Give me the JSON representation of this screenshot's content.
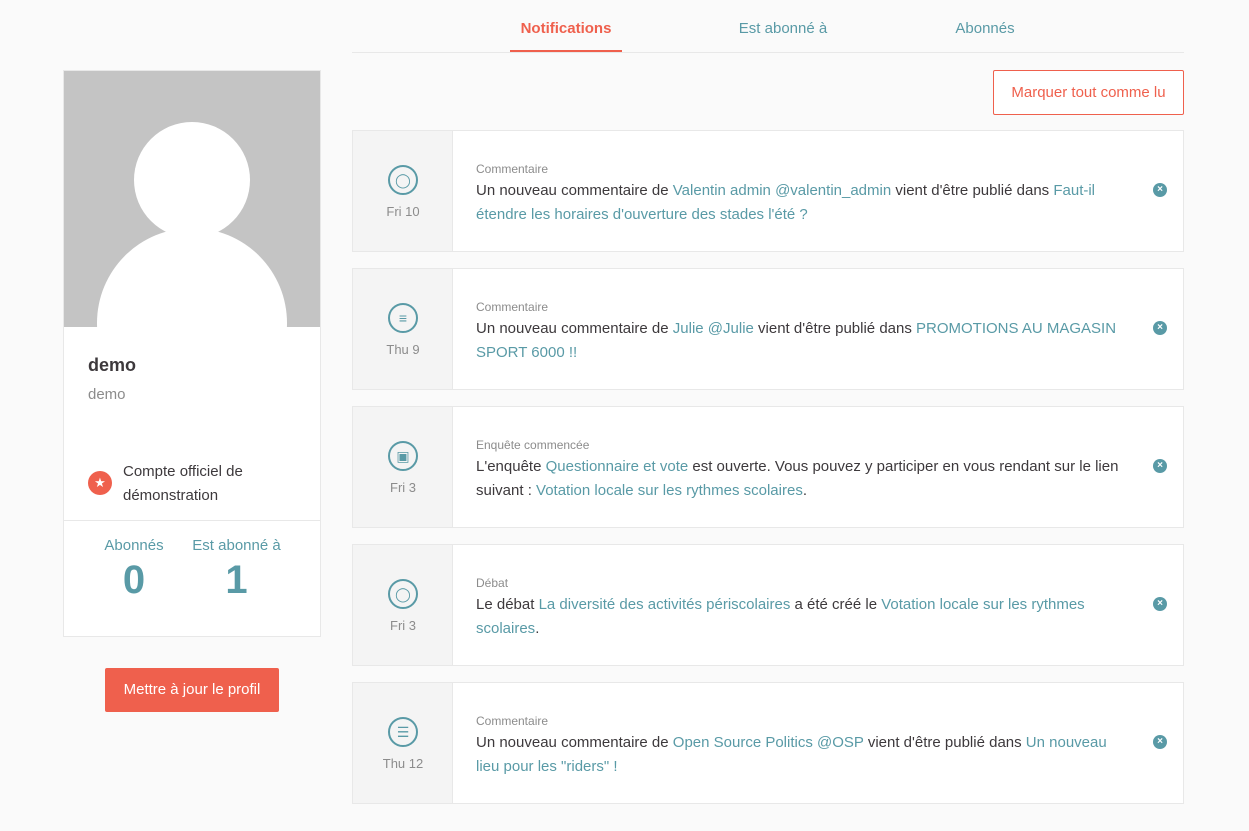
{
  "tabs": [
    {
      "label": "Notifications"
    },
    {
      "label": "Est abonné à"
    },
    {
      "label": "Abonnés"
    }
  ],
  "profile": {
    "name": "demo",
    "nickname": "demo",
    "official_label": "Compte officiel de démonstration",
    "followers_label": "Abonnés",
    "followers_count": "0",
    "following_label": "Est abonné à",
    "following_count": "1",
    "update_button": "Mettre à jour le profil"
  },
  "actions": {
    "mark_all_read": "Marquer tout comme lu"
  },
  "colors": {
    "accent": "#ef604d",
    "link": "#599aa6"
  },
  "notifications": [
    {
      "icon": "comment-bubble-icon",
      "day": "Fri 10",
      "category": "Commentaire",
      "t1": "Un nouveau commentaire de ",
      "l1": "Valentin admin @valentin_admin",
      "t2": " vient d'être publié dans ",
      "l2": "Faut-il étendre les horaires d'ouverture des stades l'été ?",
      "t3": ""
    },
    {
      "icon": "list-icon",
      "day": "Thu 9",
      "category": "Commentaire",
      "t1": "Un nouveau commentaire de ",
      "l1": "Julie @Julie",
      "t2": " vient d'être publié dans ",
      "l2": "PROMOTIONS AU MAGASIN SPORT 6000 !!",
      "t3": ""
    },
    {
      "icon": "clipboard-icon",
      "day": "Fri 3",
      "category": "Enquête commencée",
      "t1": "L'enquête ",
      "l1": "Questionnaire et vote",
      "t2": " est ouverte. Vous pouvez y participer en vous rendant sur le lien suivant : ",
      "l2": "Votation locale sur les rythmes scolaires",
      "t3": "."
    },
    {
      "icon": "comment-bubble-icon",
      "day": "Fri 3",
      "category": "Débat",
      "t1": "Le débat ",
      "l1": "La diversité des activités périscolaires",
      "t2": " a été créé le ",
      "l2": "Votation locale sur les rythmes scolaires",
      "t3": "."
    },
    {
      "icon": "text-lines-icon",
      "day": "Thu 12",
      "category": "Commentaire",
      "t1": "Un nouveau commentaire de ",
      "l1": "Open Source Politics @OSP",
      "t2": " vient d'être publié dans ",
      "l2": "Un nouveau lieu pour les \"riders\" !",
      "t3": ""
    }
  ]
}
